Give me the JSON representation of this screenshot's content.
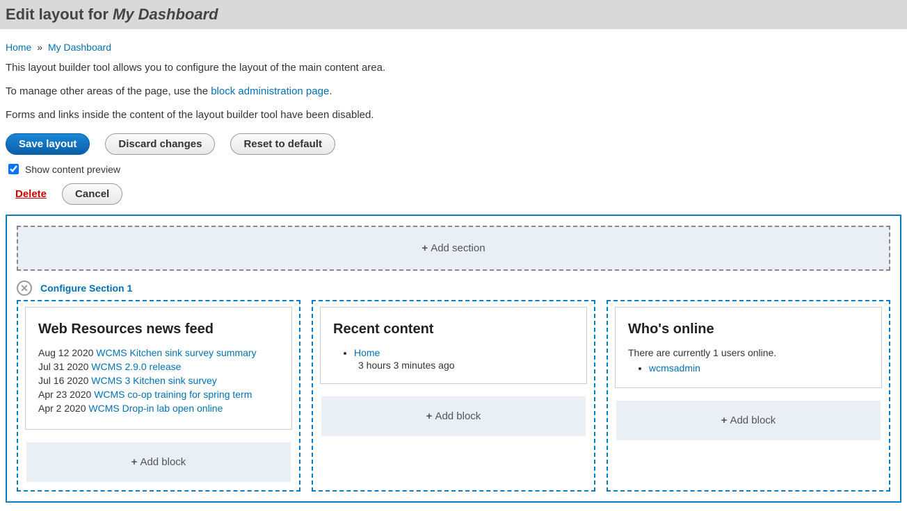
{
  "header": {
    "title_prefix": "Edit layout for ",
    "title_italic": "My Dashboard"
  },
  "breadcrumb": {
    "home": "Home",
    "separator": "»",
    "current": "My Dashboard"
  },
  "intro": {
    "line1": "This layout builder tool allows you to configure the layout of the main content area.",
    "line2a": "To manage other areas of the page, use the ",
    "line2_link": "block administration page",
    "line2_punct": ".",
    "line3": "Forms and links inside the content of the layout builder tool have been disabled."
  },
  "buttons": {
    "save": "Save layout",
    "discard": "Discard changes",
    "reset": "Reset to default",
    "delete": "Delete",
    "cancel": "Cancel"
  },
  "checkbox": {
    "show_preview": "Show content preview"
  },
  "layout": {
    "add_section": "Add section",
    "configure_section": "Configure Section 1",
    "add_block": "Add block"
  },
  "blocks": {
    "news": {
      "title": "Web Resources news feed",
      "items": [
        {
          "date": "Aug 12 2020",
          "link": "WCMS Kitchen sink survey summary"
        },
        {
          "date": "Jul 31 2020",
          "link": "WCMS 2.9.0 release"
        },
        {
          "date": "Jul 16 2020",
          "link": "WCMS 3 Kitchen sink survey"
        },
        {
          "date": "Apr 23 2020",
          "link": "WCMS co-op training for spring term"
        },
        {
          "date": "Apr 2 2020",
          "link": "WCMS Drop-in lab open online"
        }
      ]
    },
    "recent": {
      "title": "Recent content",
      "item": "Home",
      "time": "3 hours 3 minutes ago"
    },
    "online": {
      "title": "Who's online",
      "summary": "There are currently 1 users online.",
      "user": "wcmsadmin"
    }
  }
}
